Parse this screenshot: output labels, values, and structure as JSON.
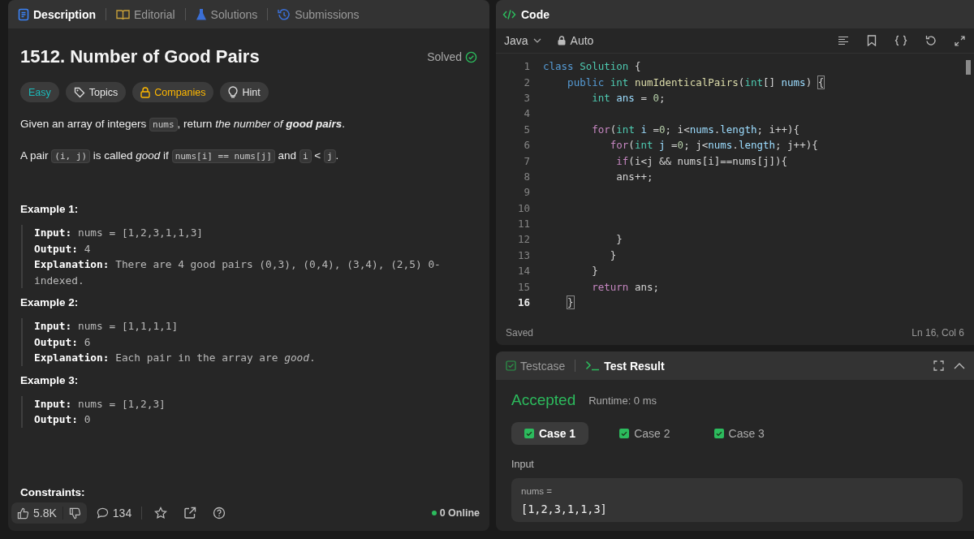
{
  "problem_panel": {
    "tabs": [
      {
        "label": "Description",
        "kind": "description",
        "selected": true
      },
      {
        "label": "Editorial",
        "kind": "editorial",
        "selected": false
      },
      {
        "label": "Solutions",
        "kind": "solutions",
        "selected": false
      },
      {
        "label": "Submissions",
        "kind": "submissions",
        "selected": false
      }
    ],
    "title": "1512. Number of Good Pairs",
    "status": "Solved",
    "tags": [
      {
        "label": "Easy",
        "kind": "difficulty"
      },
      {
        "label": "Topics",
        "kind": "topics"
      },
      {
        "label": "Companies",
        "kind": "companies"
      },
      {
        "label": "Hint",
        "kind": "hint"
      }
    ],
    "statement": [
      [
        {
          "kind": "text",
          "text": "Given an array of integers "
        },
        {
          "kind": "code",
          "text": "nums"
        },
        {
          "kind": "text",
          "text": ", return "
        },
        {
          "kind": "italic",
          "text": "the number of **good pairs**"
        },
        {
          "kind": "text",
          "text": "."
        }
      ],
      [
        {
          "kind": "text",
          "text": "A pair "
        },
        {
          "kind": "code",
          "text": "(i, j)"
        },
        {
          "kind": "text",
          "text": " is called *good* if "
        },
        {
          "kind": "code",
          "text": "nums[i] == nums[j]"
        },
        {
          "kind": "text",
          "text": " and "
        },
        {
          "kind": "code",
          "text": "i"
        },
        {
          "kind": "text",
          "text": " < "
        },
        {
          "kind": "code",
          "text": "j"
        },
        {
          "kind": "text",
          "text": "."
        }
      ]
    ],
    "examples": [
      {
        "heading": "Example 1:",
        "lines": [
          {
            "label": "Input:",
            "value": "nums = [1,2,3,1,1,3]"
          },
          {
            "label": "Output:",
            "value": "4"
          },
          {
            "label": "Explanation:",
            "value": "There are 4 good pairs (0,3), (0,4), (3,4), (2,5) 0-indexed."
          }
        ]
      },
      {
        "heading": "Example 2:",
        "lines": [
          {
            "label": "Input:",
            "value": "nums = [1,1,1,1]"
          },
          {
            "label": "Output:",
            "value": "6"
          },
          {
            "label": "Explanation:",
            "value": "Each pair in the array are *good*."
          }
        ]
      },
      {
        "heading": "Example 3:",
        "lines": [
          {
            "label": "Input:",
            "value": "nums = [1,2,3]"
          },
          {
            "label": "Output:",
            "value": "0"
          }
        ]
      }
    ],
    "constraints_heading": "Constraints:",
    "footer": {
      "likes": "5.8K",
      "comments": "134",
      "online": "0 Online"
    }
  },
  "code_panel": {
    "title": "Code",
    "language": "Java",
    "mode": "Auto",
    "lines": [
      {
        "number": "1",
        "current": false,
        "tokens": [
          {
            "text": "class ",
            "kind": "keyword"
          },
          {
            "text": "Solution",
            "kind": "type"
          },
          {
            "text": " {",
            "kind": "plain"
          }
        ]
      },
      {
        "number": "2",
        "current": false,
        "tokens": [
          {
            "text": "    public ",
            "kind": "keyword"
          },
          {
            "text": "int ",
            "kind": "type"
          },
          {
            "text": "numIdenticalPairs",
            "kind": "function"
          },
          {
            "text": "(",
            "kind": "plain"
          },
          {
            "text": "int",
            "kind": "type"
          },
          {
            "text": "[] ",
            "kind": "plain"
          },
          {
            "text": "nums",
            "kind": "variable"
          },
          {
            "text": ") ",
            "kind": "plain"
          },
          {
            "text": "{",
            "kind": "match"
          }
        ]
      },
      {
        "number": "3",
        "current": false,
        "tokens": [
          {
            "text": "        int ",
            "kind": "type"
          },
          {
            "text": "ans",
            "kind": "variable"
          },
          {
            "text": " = ",
            "kind": "plain"
          },
          {
            "text": "0",
            "kind": "number"
          },
          {
            "text": ";",
            "kind": "plain"
          }
        ]
      },
      {
        "number": "4",
        "current": false
      },
      {
        "number": "5",
        "current": false,
        "tokens": [
          {
            "text": "        for",
            "kind": "control"
          },
          {
            "text": "(",
            "kind": "plain"
          },
          {
            "text": "int ",
            "kind": "type"
          },
          {
            "text": "i",
            "kind": "variable"
          },
          {
            "text": " =",
            "kind": "plain"
          },
          {
            "text": "0",
            "kind": "number"
          },
          {
            "text": "; i<",
            "kind": "plain"
          },
          {
            "text": "nums",
            "kind": "variable"
          },
          {
            "text": ".",
            "kind": "plain"
          },
          {
            "text": "length",
            "kind": "variable"
          },
          {
            "text": "; i++){",
            "kind": "plain"
          }
        ]
      },
      {
        "number": "6",
        "current": false,
        "tokens": [
          {
            "text": "           for",
            "kind": "control"
          },
          {
            "text": "(",
            "kind": "plain"
          },
          {
            "text": "int ",
            "kind": "type"
          },
          {
            "text": "j",
            "kind": "variable"
          },
          {
            "text": " =",
            "kind": "plain"
          },
          {
            "text": "0",
            "kind": "number"
          },
          {
            "text": "; j<",
            "kind": "plain"
          },
          {
            "text": "nums",
            "kind": "variable"
          },
          {
            "text": ".",
            "kind": "plain"
          },
          {
            "text": "length",
            "kind": "variable"
          },
          {
            "text": "; j++){",
            "kind": "plain"
          }
        ]
      },
      {
        "number": "7",
        "current": false,
        "tokens": [
          {
            "text": "            if",
            "kind": "control"
          },
          {
            "text": "(i<j && nums[i]==nums[j]){",
            "kind": "plain"
          }
        ]
      },
      {
        "number": "8",
        "current": false,
        "tokens": [
          {
            "text": "            ans++;",
            "kind": "plain"
          }
        ]
      },
      {
        "number": "9",
        "current": false
      },
      {
        "number": "10",
        "current": false
      },
      {
        "number": "11",
        "current": false
      },
      {
        "number": "12",
        "current": false,
        "tokens": [
          {
            "text": "            }",
            "kind": "plain"
          }
        ]
      },
      {
        "number": "13",
        "current": false,
        "tokens": [
          {
            "text": "           }",
            "kind": "plain"
          }
        ]
      },
      {
        "number": "14",
        "current": false,
        "tokens": [
          {
            "text": "        }",
            "kind": "plain"
          }
        ]
      },
      {
        "number": "15",
        "current": false,
        "tokens": [
          {
            "text": "        return ",
            "kind": "control"
          },
          {
            "text": "ans;",
            "kind": "plain"
          }
        ]
      },
      {
        "number": "16",
        "current": true,
        "tokens": [
          {
            "text": "    }",
            "kind": "match"
          }
        ]
      }
    ],
    "save_status": "Saved",
    "cursor": "Ln 16, Col 6"
  },
  "result_panel": {
    "tabs": [
      {
        "label": "Testcase",
        "kind": "testcase",
        "selected": false
      },
      {
        "label": "Test Result",
        "kind": "result",
        "selected": true
      }
    ],
    "verdict": "Accepted",
    "runtime": "Runtime: 0 ms",
    "cases": [
      {
        "label": "Case 1",
        "selected": true,
        "passed": true
      },
      {
        "label": "Case 2",
        "selected": false,
        "passed": true
      },
      {
        "label": "Case 3",
        "selected": false,
        "passed": true
      }
    ],
    "input_label": "Input",
    "param_name": "nums =",
    "param_value": "[1,2,3,1,1,3]"
  }
}
